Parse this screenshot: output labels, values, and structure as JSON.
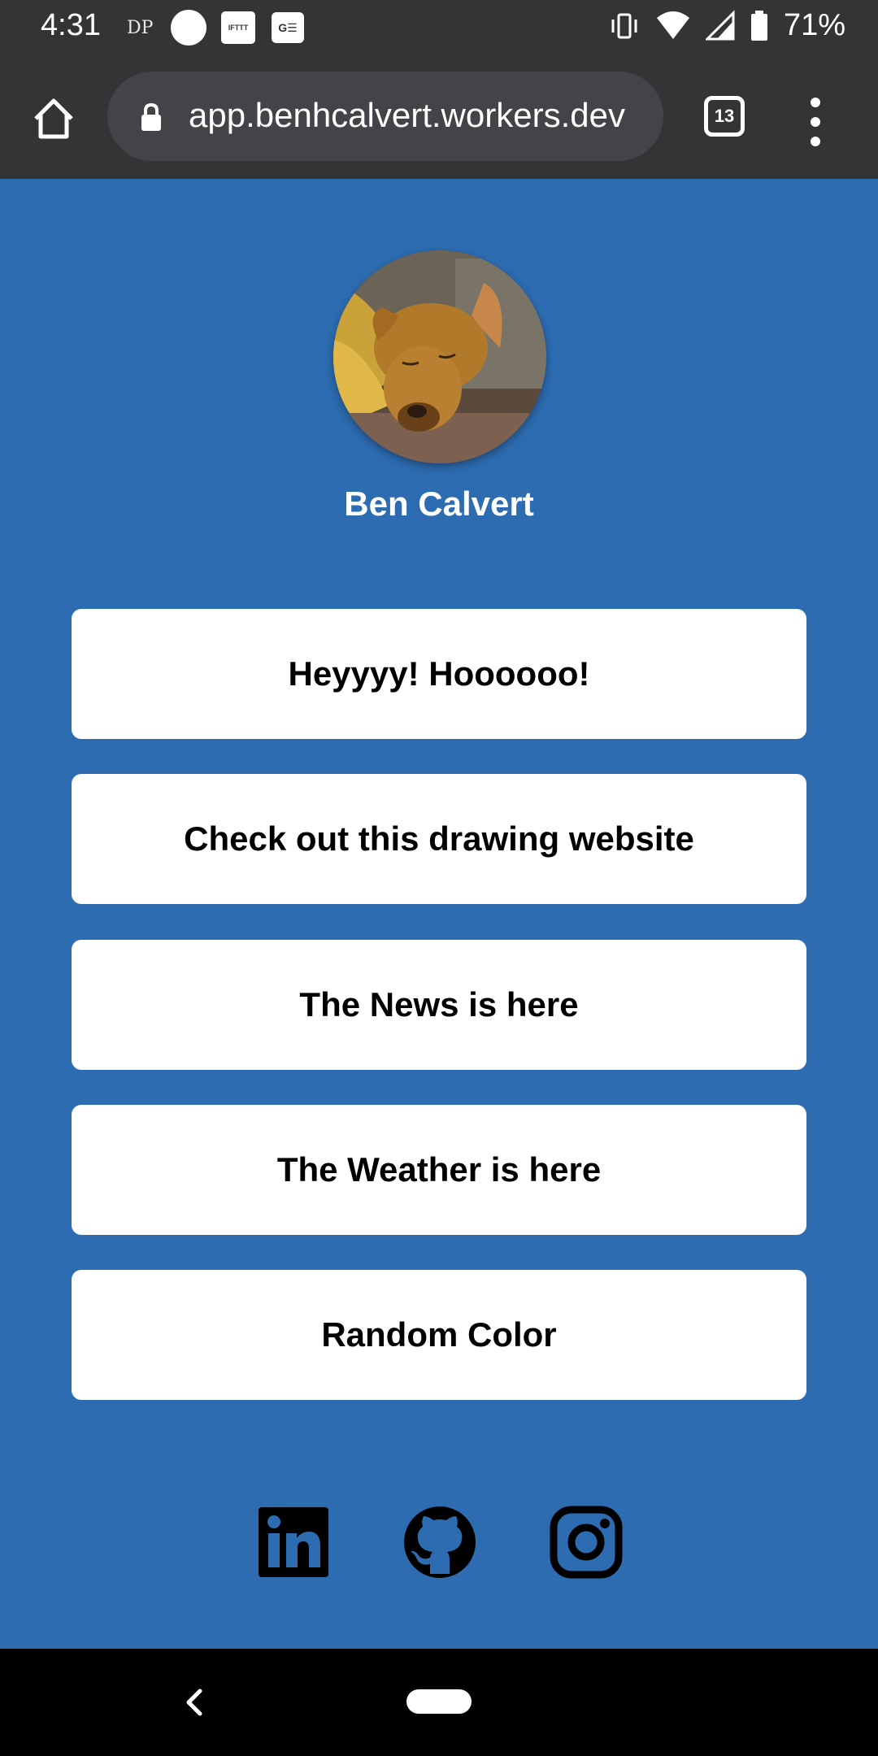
{
  "status_bar": {
    "time": "4:31",
    "dp_label": "DP",
    "ifttt_label": "IFTTT",
    "news_label": "G☰",
    "battery_percent": "71%"
  },
  "browser": {
    "url": "app.benhcalvert.workers.dev",
    "tab_count": "13"
  },
  "profile": {
    "name": "Ben Calvert"
  },
  "links": [
    {
      "label": "Heyyyy! Hoooooo!"
    },
    {
      "label": "Check out this drawing website"
    },
    {
      "label": "The News is here"
    },
    {
      "label": "The Weather is here"
    },
    {
      "label": "Random Color"
    }
  ],
  "social": [
    "linkedin-icon",
    "github-icon",
    "instagram-icon"
  ],
  "colors": {
    "page_background": "#2d6cb1",
    "browser_chrome": "#333436",
    "button_background": "#ffffff",
    "text_dark": "#000000"
  }
}
